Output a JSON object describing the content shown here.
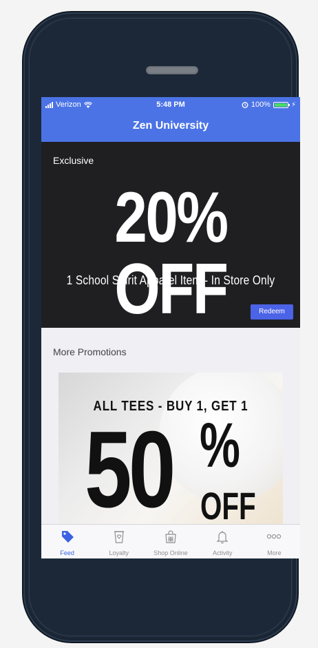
{
  "status_bar": {
    "carrier": "Verizon",
    "time": "5:48 PM",
    "battery": "100%"
  },
  "header": {
    "title": "Zen University"
  },
  "hero": {
    "tag": "Exclusive",
    "headline": "20% OFF",
    "subtitle": "1 School Spirit Apparel Item - In Store Only",
    "redeem_label": "Redeem"
  },
  "promotions": {
    "section_title": "More Promotions",
    "card": {
      "line": "ALL TEES - BUY 1, GET 1",
      "number": "50",
      "percent": "%",
      "off": "OFF"
    }
  },
  "tabbar": {
    "items": [
      {
        "label": "Feed",
        "icon": "tag-icon",
        "active": true
      },
      {
        "label": "Loyalty",
        "icon": "cup-icon",
        "active": false
      },
      {
        "label": "Shop Online",
        "icon": "shopping-bag-icon",
        "active": false
      },
      {
        "label": "Activity",
        "icon": "bell-icon",
        "active": false
      },
      {
        "label": "More",
        "icon": "more-dots-icon",
        "active": false
      }
    ]
  },
  "colors": {
    "accent": "#4b73e6",
    "hero_bg": "#1f1f22",
    "redeem_bg": "#4b63e6",
    "tab_active": "#3b62e3",
    "phone_body": "#1e2b3a"
  }
}
